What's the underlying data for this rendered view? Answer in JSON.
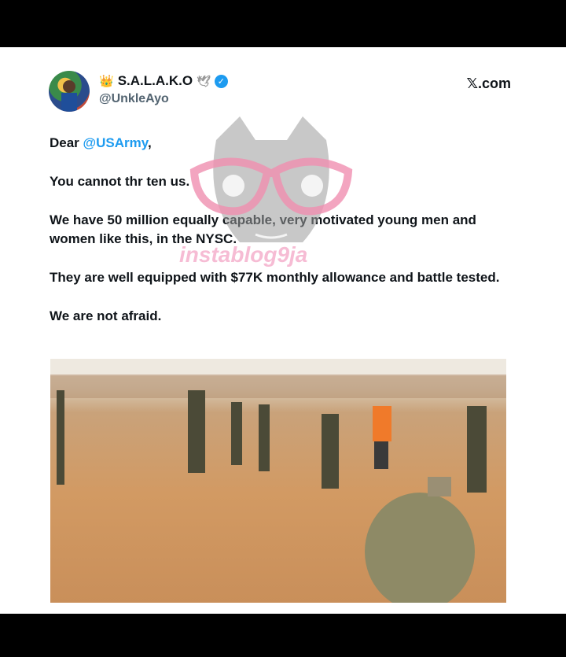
{
  "tweet": {
    "display_name": "S.A.L.A.K.O",
    "name_prefix_emoji": "👑",
    "name_suffix_emoji": "🕊",
    "handle": "@UnkleAyo",
    "source": "𝕏.com",
    "verified": true,
    "greeting_prefix": "Dear ",
    "mention": "@USArmy",
    "greeting_suffix": ",",
    "line2": "You cannot thr ten us.",
    "line3": "We have 50 million equally capable, very motivated young men and women like this, in the NYSC.",
    "line4": "They are well equipped with $77K monthly allowance and battle tested.",
    "line5": "We are not afraid."
  },
  "watermark": {
    "text": "instablog9ja"
  },
  "colors": {
    "link": "#1d9bf0",
    "watermark_pink": "#f4a6c6",
    "background": "#000000"
  }
}
